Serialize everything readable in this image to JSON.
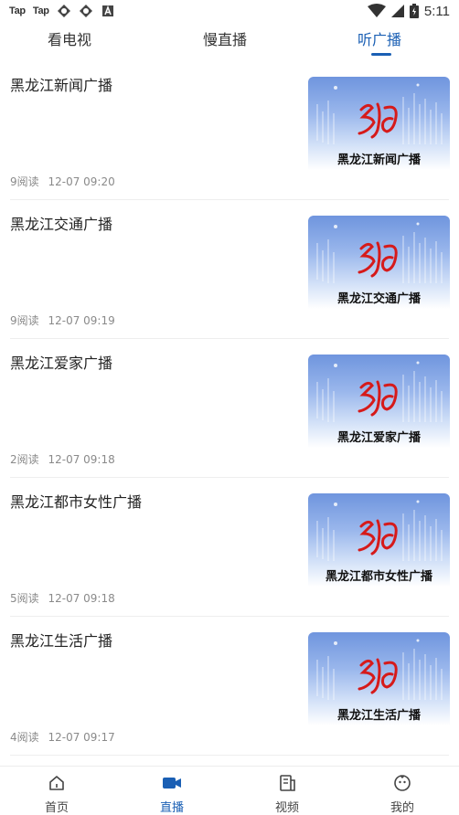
{
  "status_bar": {
    "apps": [
      "Tap",
      "Tap"
    ],
    "time": "5:11"
  },
  "tabs": [
    {
      "label": "看电视",
      "active": false
    },
    {
      "label": "慢直播",
      "active": false
    },
    {
      "label": "听广播",
      "active": true
    }
  ],
  "items": [
    {
      "title": "黑龙江新闻广播",
      "reads": "9阅读",
      "time": "12-07 09:20",
      "thumb_caption": "黑龙江新闻广播"
    },
    {
      "title": "黑龙江交通广播",
      "reads": "9阅读",
      "time": "12-07 09:19",
      "thumb_caption": "黑龙江交通广播"
    },
    {
      "title": "黑龙江爱家广播",
      "reads": "2阅读",
      "time": "12-07 09:18",
      "thumb_caption": "黑龙江爱家广播"
    },
    {
      "title": "黑龙江都市女性广播",
      "reads": "5阅读",
      "time": "12-07 09:18",
      "thumb_caption": "黑龙江都市女性广播"
    },
    {
      "title": "黑龙江生活广播",
      "reads": "4阅读",
      "time": "12-07 09:17",
      "thumb_caption": "黑龙江生活广播"
    }
  ],
  "bottom_nav": [
    {
      "label": "首页",
      "icon": "home-icon",
      "active": false
    },
    {
      "label": "直播",
      "icon": "video-camera-icon",
      "active": true
    },
    {
      "label": "视频",
      "icon": "video-book-icon",
      "active": false
    },
    {
      "label": "我的",
      "icon": "profile-face-icon",
      "active": false
    }
  ],
  "colors": {
    "accent": "#1a5fb4",
    "meta_text": "#8a8a8a"
  }
}
